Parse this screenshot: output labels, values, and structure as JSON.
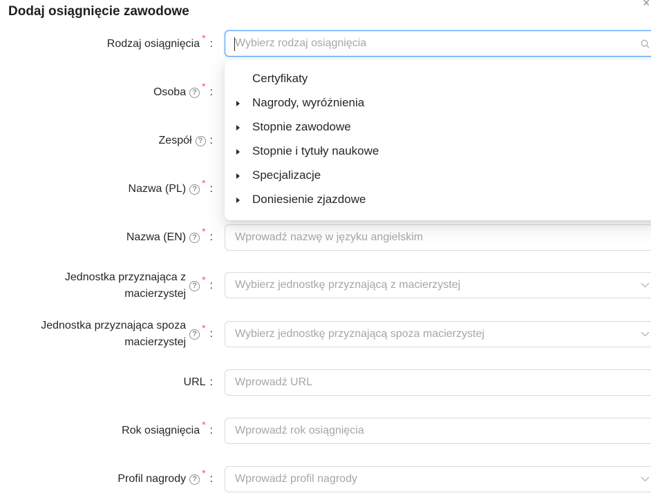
{
  "dialog": {
    "title": "Dodaj osiągnięcie zawodowe",
    "close_glyph": "×"
  },
  "fields": [
    {
      "label": "Rodzaj osiągnięcia",
      "help": false,
      "required": true,
      "placeholder": "Wybierz rodzaj osiągnięcia",
      "type": "search-select",
      "suffix_icon": "search-icon"
    },
    {
      "label": "Osoba",
      "help": true,
      "required": true
    },
    {
      "label": "Zespół",
      "help": true,
      "required": false
    },
    {
      "label": "Nazwa (PL)",
      "help": true,
      "required": true
    },
    {
      "label": "Nazwa (EN)",
      "help": true,
      "required": true,
      "placeholder": "Wprowadź nazwę w języku angielskim",
      "type": "text"
    },
    {
      "label_line1": "Jednostka przyznająca z",
      "label_line2": "macierzystej",
      "help": true,
      "required": true,
      "placeholder": "Wybierz jednostkę przyznającą z macierzystej",
      "type": "select",
      "suffix_icon": "chevron-down-icon"
    },
    {
      "label_line1": "Jednostka przyznająca spoza",
      "label_line2": "macierzystej",
      "help": true,
      "required": true,
      "placeholder": "Wybierz jednostkę przyznającą spoza macierzystej",
      "type": "select",
      "suffix_icon": "chevron-down-icon"
    },
    {
      "label": "URL",
      "help": false,
      "required": false,
      "placeholder": "Wprowadź URL",
      "type": "text"
    },
    {
      "label": "Rok osiągnięcia",
      "help": false,
      "required": true,
      "placeholder": "Wprowadź rok osiągnięcia",
      "type": "text"
    },
    {
      "label": "Profil nagrody",
      "help": true,
      "required": true,
      "placeholder": "Wprowadź profil nagrody",
      "type": "select",
      "suffix_icon": "chevron-down-icon"
    }
  ],
  "glyphs": {
    "colon": ":",
    "required_mark": "*",
    "help_mark": "?"
  },
  "dropdown": {
    "items": [
      {
        "label": "Certyfikaty",
        "expandable": false
      },
      {
        "label": "Nagrody, wyróżnienia",
        "expandable": true
      },
      {
        "label": "Stopnie zawodowe",
        "expandable": true
      },
      {
        "label": "Stopnie i tytuły naukowe",
        "expandable": true
      },
      {
        "label": "Specjalizacje",
        "expandable": true
      },
      {
        "label": "Doniesienie zjazdowe",
        "expandable": true
      }
    ]
  }
}
